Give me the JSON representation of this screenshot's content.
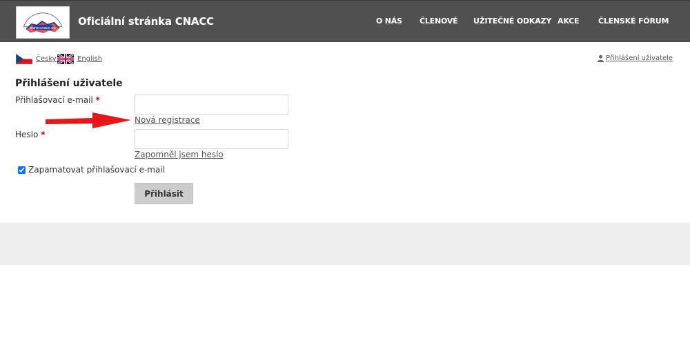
{
  "header": {
    "site_title": "Oficiální stránka CNACC",
    "logo_text": "www.cnacc.eu",
    "nav": [
      "O NÁS",
      "ČLENOVÉ",
      "UŽITEČNÉ ODKAZY",
      "AKCE",
      "ČLENSKÉ FÓRUM"
    ]
  },
  "languages": {
    "czech": "Česky",
    "english": "English"
  },
  "user_link": "Přihlášení uživatele",
  "form": {
    "heading": "Přihlášení uživatele",
    "email_label": "Přihlašovací e-mail",
    "required_mark": "*",
    "email_value": "",
    "new_registration": "Nová registrace",
    "password_label": "Heslo",
    "password_value": "",
    "forgot_password": "Zapomněl jsem heslo",
    "remember_label": "Zapamatovat přihlašovací e-mail",
    "remember_checked": true,
    "submit_label": "Přihlásit"
  },
  "colors": {
    "header_bg": "#505050",
    "required": "#cc0000",
    "arrow": "#e8151b",
    "footer_band": "#eeeeee"
  }
}
